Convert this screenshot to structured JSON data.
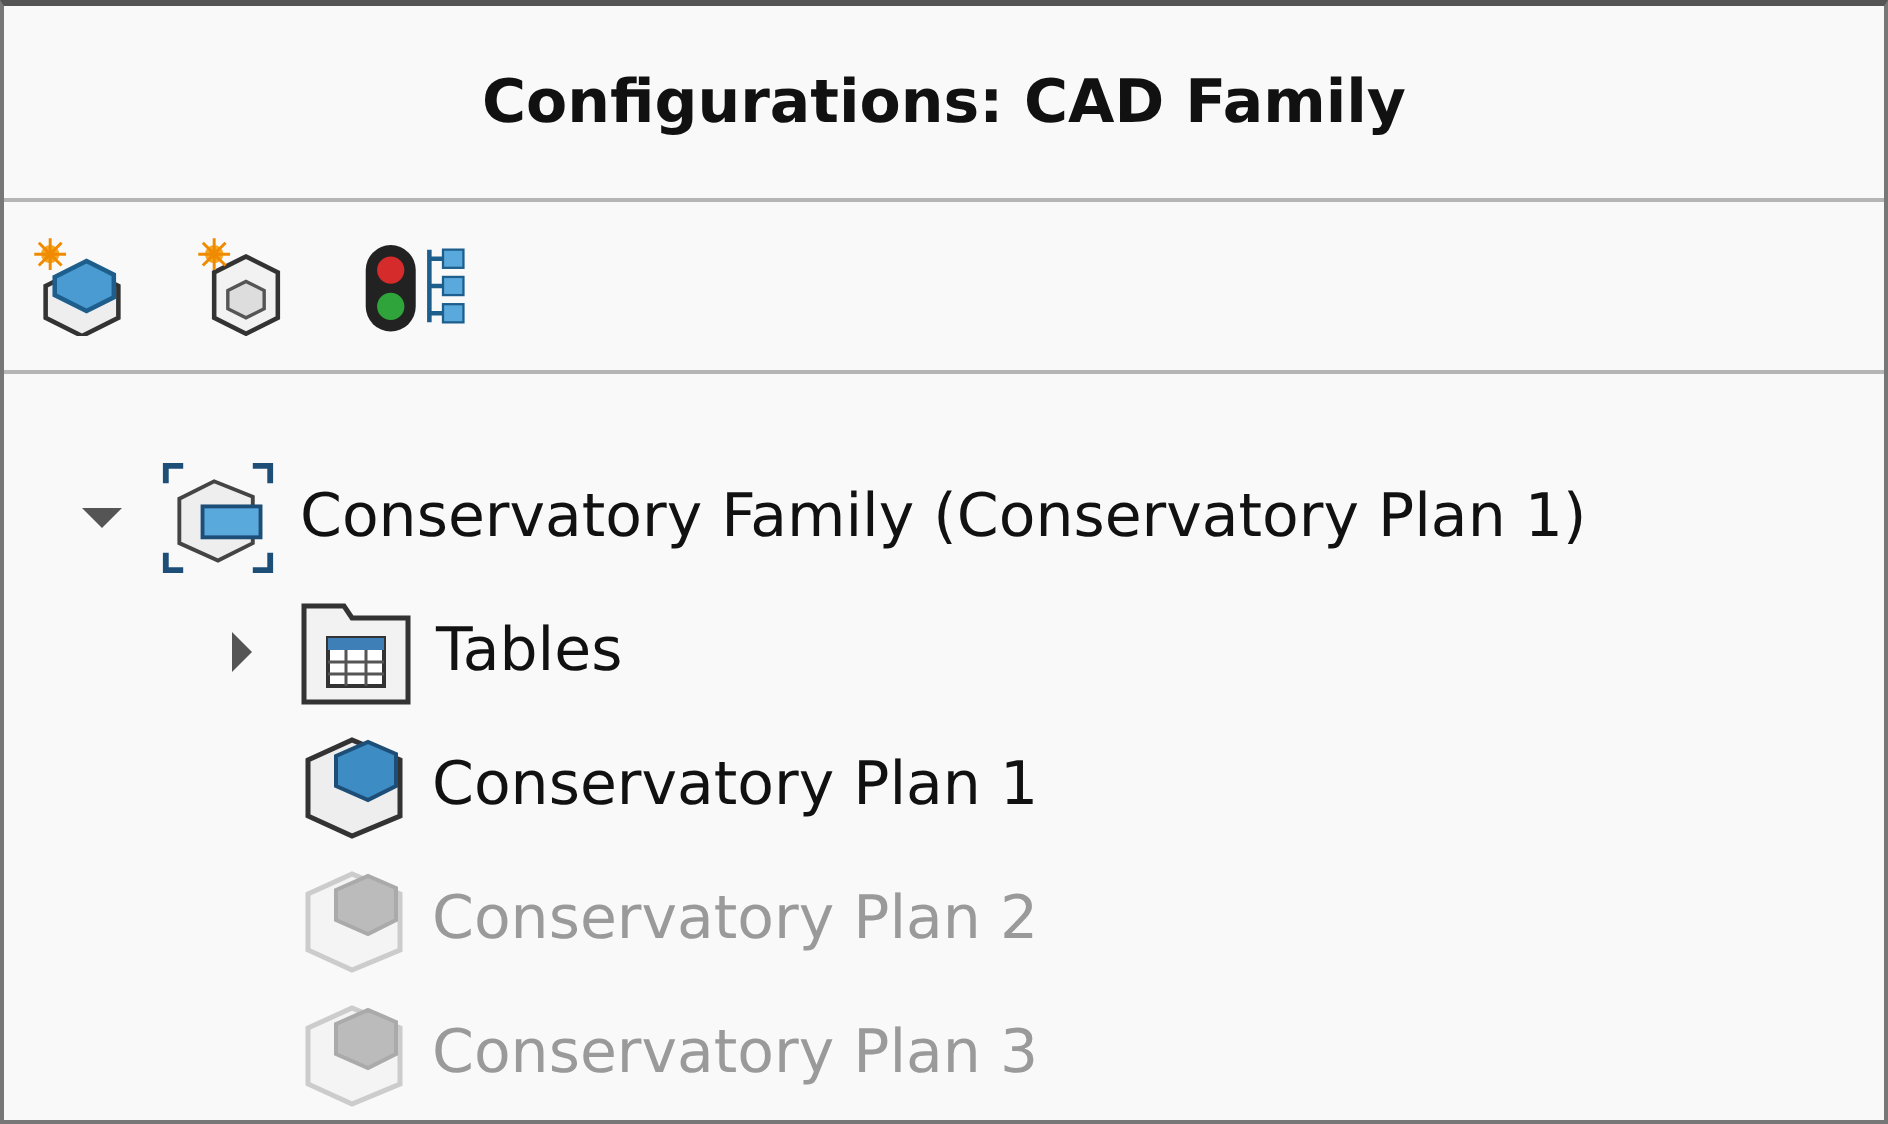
{
  "panel": {
    "title": "Configurations: CAD Family"
  },
  "toolbar": [
    {
      "kind": "add-configuration"
    },
    {
      "kind": "add-derived"
    },
    {
      "kind": "display-states"
    }
  ],
  "tree": [
    {
      "kind": "family",
      "label": "Conservatory Family  (Conservatory Plan 1)",
      "expanded": true,
      "children": [
        {
          "kind": "folder",
          "label": "Tables",
          "expanded": false
        },
        {
          "kind": "configuration",
          "label": "Conservatory Plan 1",
          "active": true
        },
        {
          "kind": "configuration",
          "label": "Conservatory Plan 2",
          "active": false
        },
        {
          "kind": "configuration",
          "label": "Conservatory Plan 3",
          "active": false
        }
      ]
    }
  ]
}
